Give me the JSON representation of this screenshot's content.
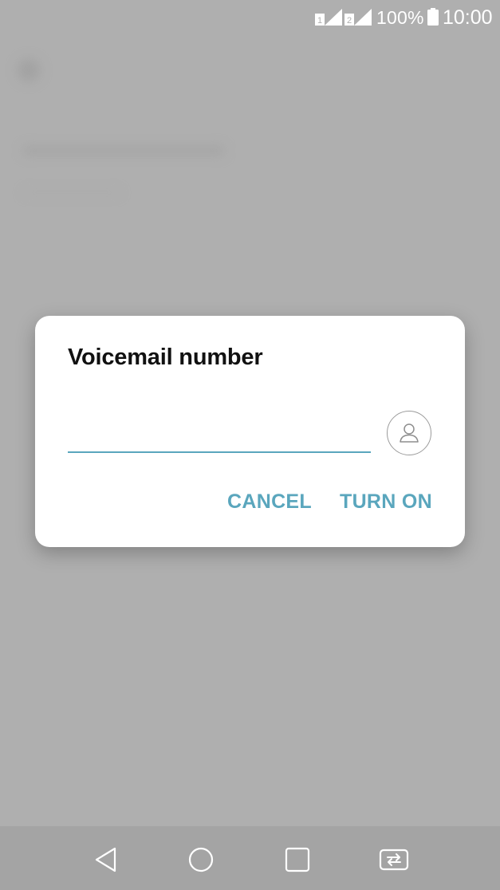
{
  "status_bar": {
    "sim1_label": "1",
    "sim2_label": "2",
    "battery_percent": "100%",
    "time": "10:00",
    "icons": [
      "sim1-signal-icon",
      "sim2-signal-icon",
      "battery-icon"
    ]
  },
  "dialog": {
    "title": "Voicemail number",
    "input_value": "",
    "input_placeholder": "",
    "contact_icon": "contact-picker-icon",
    "cancel_label": "CANCEL",
    "turn_on_label": "TURN ON"
  },
  "nav_bar": {
    "icons": [
      "back-icon",
      "home-icon",
      "recents-icon",
      "dual-window-icon"
    ]
  },
  "colors": {
    "accent": "#5aa6bd",
    "scrim": "#afafaf",
    "dialog_bg": "#ffffff",
    "title_text": "#111111",
    "nav_bar": "#a4a4a4"
  }
}
